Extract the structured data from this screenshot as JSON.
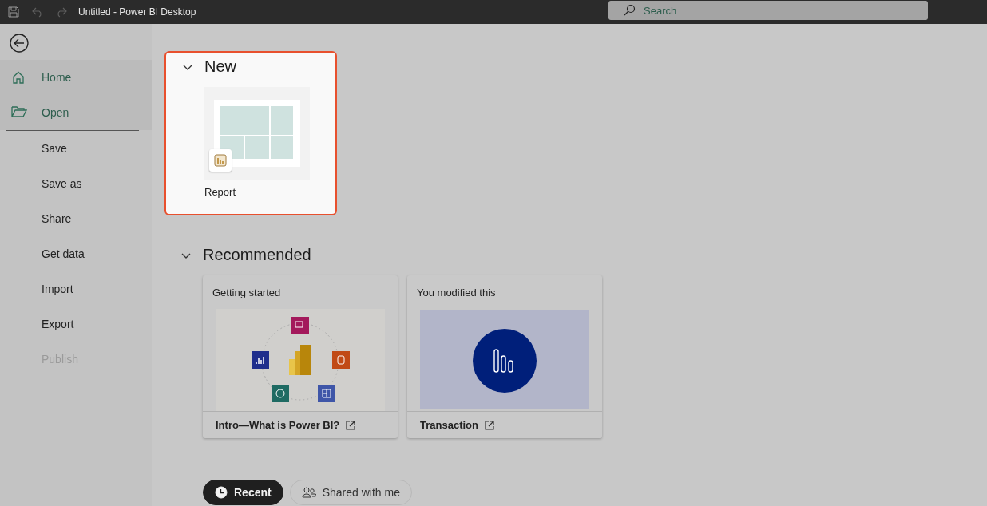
{
  "window": {
    "title": "Untitled - Power BI Desktop"
  },
  "search": {
    "placeholder": "Search"
  },
  "sidebar": {
    "items": [
      {
        "label": "Home",
        "kind": "home",
        "disabled": false
      },
      {
        "label": "Open",
        "kind": "open",
        "disabled": false
      },
      {
        "label": "Save",
        "kind": "plain",
        "disabled": false
      },
      {
        "label": "Save as",
        "kind": "plain",
        "disabled": false
      },
      {
        "label": "Share",
        "kind": "plain",
        "disabled": false
      },
      {
        "label": "Get data",
        "kind": "plain",
        "disabled": false
      },
      {
        "label": "Import",
        "kind": "plain",
        "disabled": false
      },
      {
        "label": "Export",
        "kind": "plain",
        "disabled": false
      },
      {
        "label": "Publish",
        "kind": "plain",
        "disabled": true
      }
    ]
  },
  "new_section": {
    "title": "New",
    "expanded": true,
    "highlighted": true,
    "items": [
      {
        "label": "Report"
      }
    ]
  },
  "recommended": {
    "title": "Recommended",
    "expanded": true,
    "cards": [
      {
        "heading": "Getting started",
        "title": "Intro—What is Power BI?",
        "kind": "getting-started"
      },
      {
        "heading": "You modified this",
        "title": "Transaction",
        "kind": "report"
      }
    ]
  },
  "tabs": [
    {
      "label": "Recent",
      "selected": true
    },
    {
      "label": "Shared with me",
      "selected": false
    }
  ]
}
